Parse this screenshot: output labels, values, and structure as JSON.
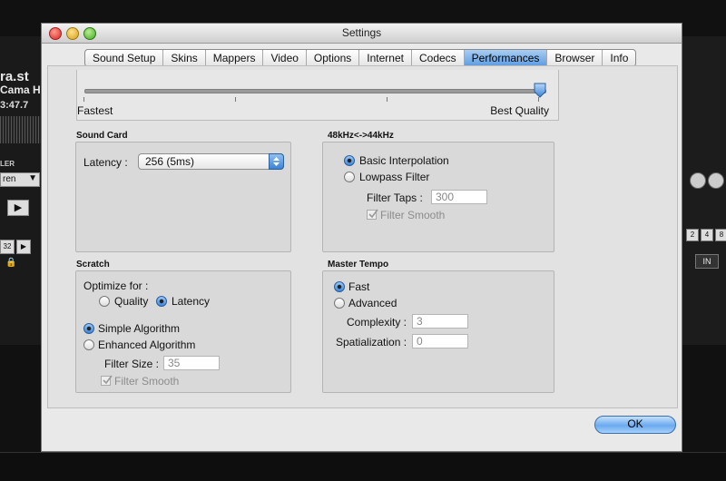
{
  "window": {
    "title": "Settings"
  },
  "tabs": [
    {
      "label": "Sound Setup",
      "active": false
    },
    {
      "label": "Skins",
      "active": false
    },
    {
      "label": "Mappers",
      "active": false
    },
    {
      "label": "Video",
      "active": false
    },
    {
      "label": "Options",
      "active": false
    },
    {
      "label": "Internet",
      "active": false
    },
    {
      "label": "Codecs",
      "active": false
    },
    {
      "label": "Performances",
      "active": true
    },
    {
      "label": "Browser",
      "active": false
    },
    {
      "label": "Info",
      "active": false
    }
  ],
  "quality_slider": {
    "min_label": "Fastest",
    "max_label": "Best Quality",
    "value": 1.0
  },
  "sound_card": {
    "title": "Sound Card",
    "latency_label": "Latency :",
    "latency_value": "256 (5ms)"
  },
  "resampling": {
    "title": "48kHz<->44kHz",
    "basic_label": "Basic Interpolation",
    "basic_selected": true,
    "lowpass_label": "Lowpass Filter",
    "lowpass_selected": false,
    "filter_taps_label": "Filter Taps :",
    "filter_taps_value": "300",
    "filter_smooth_label": "Filter Smooth",
    "filter_smooth_checked": true
  },
  "scratch": {
    "title": "Scratch",
    "optimize_label": "Optimize for :",
    "quality_label": "Quality",
    "quality_selected": false,
    "latency_label": "Latency",
    "latency_selected": true,
    "simple_label": "Simple Algorithm",
    "simple_selected": true,
    "enhanced_label": "Enhanced Algorithm",
    "enhanced_selected": false,
    "filter_size_label": "Filter Size :",
    "filter_size_value": "35",
    "filter_smooth_label": "Filter Smooth",
    "filter_smooth_checked": true
  },
  "master_tempo": {
    "title": "Master Tempo",
    "fast_label": "Fast",
    "fast_selected": true,
    "advanced_label": "Advanced",
    "advanced_selected": false,
    "complexity_label": "Complexity :",
    "complexity_value": "3",
    "spatialization_label": "Spatialization :",
    "spatialization_value": "0"
  },
  "ok_label": "OK",
  "background_app": {
    "deck_title": "ra.st",
    "deck_subtitle": "Cama H",
    "deck_time": "3:47.7",
    "dropdown_text": "ren",
    "label_ler": "LER",
    "btn_32": "32",
    "btn_in": "IN",
    "btn_2": "2",
    "btn_4": "4",
    "btn_8": "8"
  }
}
